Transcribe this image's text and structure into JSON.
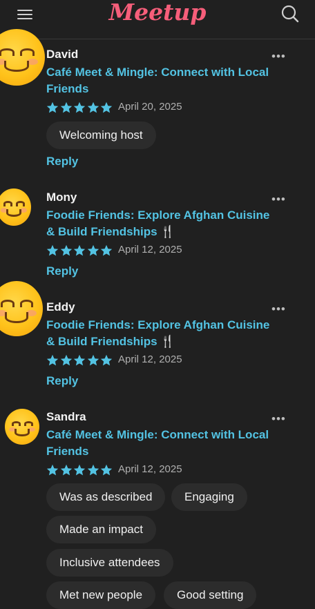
{
  "header": {
    "logo": "Meetup",
    "menu_icon": "hamburger-menu-icon",
    "search_icon": "search-icon"
  },
  "colors": {
    "accent": "#53c3e3",
    "brand": "#f65e7a",
    "background": "#202020"
  },
  "reviews": [
    {
      "name": "David",
      "event": "Café Meet & Mingle: Connect with Local Friends",
      "rating": 5,
      "date": "April 20, 2025",
      "tags": [
        "Welcoming host"
      ],
      "reply": "Reply",
      "more": "•••"
    },
    {
      "name": "Mony",
      "event": "Foodie Friends: Explore Afghan Cuisine & Build Friendships 🍴",
      "rating": 5,
      "date": "April 12, 2025",
      "tags": [],
      "reply": "Reply",
      "more": "•••"
    },
    {
      "name": "Eddy",
      "event": "Foodie Friends: Explore Afghan Cuisine & Build Friendships 🍴",
      "rating": 5,
      "date": "April 12, 2025",
      "tags": [],
      "reply": "Reply",
      "more": "•••"
    },
    {
      "name": "Sandra",
      "event": "Café Meet & Mingle: Connect with Local Friends",
      "rating": 5,
      "date": "April 12, 2025",
      "tags": [
        "Was as described",
        "Engaging",
        "Made an impact",
        "Inclusive attendees",
        "Met new people",
        "Good setting"
      ],
      "more": "•••"
    }
  ]
}
